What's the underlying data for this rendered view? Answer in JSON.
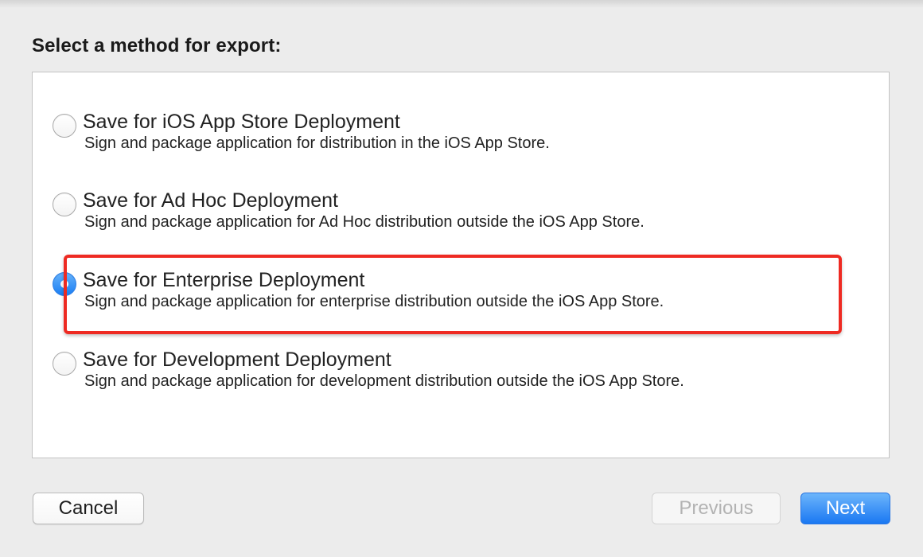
{
  "dialog": {
    "heading": "Select a method for export:"
  },
  "options": [
    {
      "title": "Save for iOS App Store Deployment",
      "description": "Sign and package application for distribution in the iOS App Store.",
      "selected": false
    },
    {
      "title": "Save for Ad Hoc Deployment",
      "description": "Sign and package application for Ad Hoc distribution outside the iOS App Store.",
      "selected": false
    },
    {
      "title": "Save for Enterprise Deployment",
      "description": "Sign and package application for enterprise distribution outside the iOS App Store.",
      "selected": true
    },
    {
      "title": "Save for Development Deployment",
      "description": "Sign and package application for development distribution outside the iOS App Store.",
      "selected": false
    }
  ],
  "buttons": {
    "cancel": "Cancel",
    "previous": "Previous",
    "next": "Next",
    "previous_enabled": false
  },
  "colors": {
    "accent": "#1a7ef3",
    "highlight": "#ee2a22",
    "background": "#ececec"
  }
}
